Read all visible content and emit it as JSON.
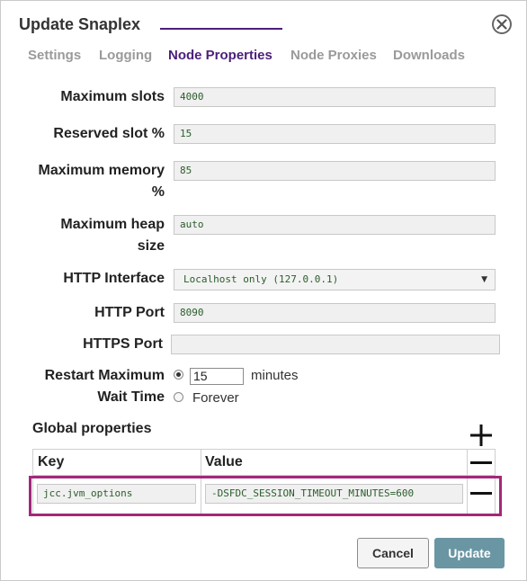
{
  "dialog": {
    "title": "Update Snaplex"
  },
  "tabs": [
    {
      "label": "Settings",
      "active": false
    },
    {
      "label": "Logging",
      "active": false
    },
    {
      "label": "Node Properties",
      "active": true
    },
    {
      "label": "Node Proxies",
      "active": false
    },
    {
      "label": "Downloads",
      "active": false
    }
  ],
  "form": {
    "max_slots": {
      "label": "Maximum slots",
      "value": "4000"
    },
    "reserved_slot": {
      "label": "Reserved slot %",
      "value": "15"
    },
    "max_memory": {
      "label_line1": "Maximum memory",
      "label_line2": "%",
      "value": "85"
    },
    "max_heap": {
      "label_line1": "Maximum heap",
      "label_line2": "size",
      "value": "auto"
    },
    "http_interface": {
      "label": "HTTP Interface",
      "value": "Localhost only (127.0.0.1)"
    },
    "http_port": {
      "label": "HTTP Port",
      "value": "8090"
    },
    "https_port": {
      "label": "HTTPS Port",
      "value": ""
    },
    "restart": {
      "label_line1": "Restart Maximum",
      "label_line2": "Wait Time",
      "minutes_value": "15",
      "minutes_unit": "minutes",
      "forever_label": "Forever",
      "selected": "minutes"
    }
  },
  "global_properties": {
    "title": "Global properties",
    "columns": [
      "Key",
      "Value"
    ],
    "rows": [
      {
        "key": "jcc.jvm_options",
        "value": "-DSFDC_SESSION_TIMEOUT_MINUTES=600"
      }
    ]
  },
  "buttons": {
    "cancel": "Cancel",
    "update": "Update"
  },
  "colors": {
    "accent": "#4b1f7a",
    "highlight": "#a3287a",
    "primary_button": "#6a96a3"
  }
}
